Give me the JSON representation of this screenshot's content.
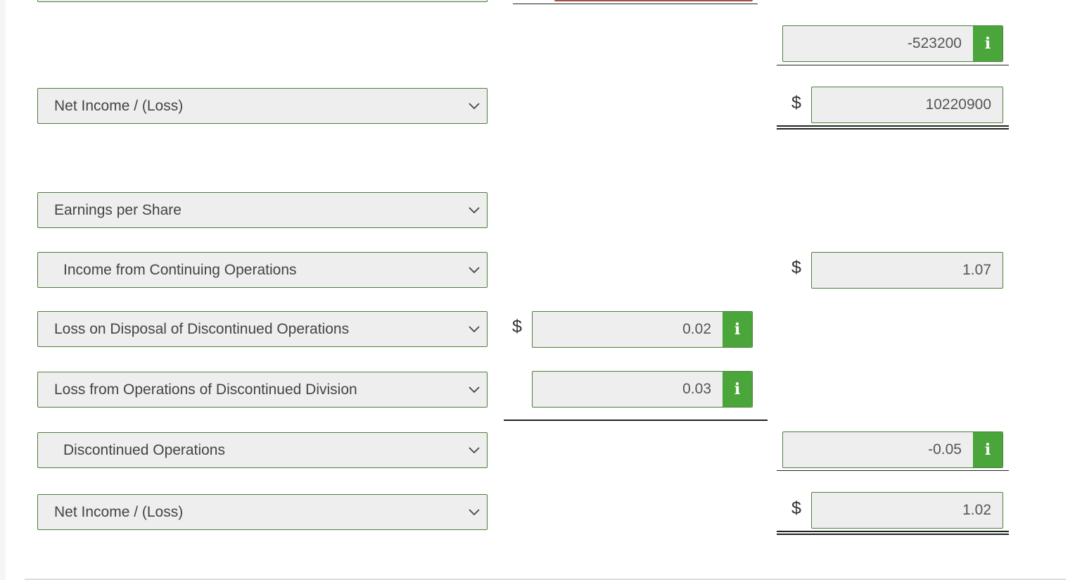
{
  "rows": {
    "net_income_1": {
      "label": "Net Income / (Loss)"
    },
    "eps_header": {
      "label": "Earnings per Share"
    },
    "income_cont_ops": {
      "label": "Income from Continuing Operations"
    },
    "loss_disposal": {
      "label": "Loss on Disposal of Discontinued Operations"
    },
    "loss_ops_disc": {
      "label": "Loss from Operations of Discontinued Division"
    },
    "discontinued_ops": {
      "label": "Discontinued Operations"
    },
    "net_income_2": {
      "label": "Net Income / (Loss)"
    }
  },
  "values": {
    "top_subtotal": "-523200",
    "net_income_total": "10220900",
    "eps_continuing": "1.07",
    "eps_loss_disposal": "0.02",
    "eps_loss_ops": "0.03",
    "eps_discontinued": "-0.05",
    "eps_net_income": "1.02"
  },
  "currency_symbol": "$",
  "info_icon_glyph": "i",
  "colors": {
    "accent": "#4aa63a",
    "border": "#4a7f3a",
    "field_bg": "#eeeeee"
  }
}
